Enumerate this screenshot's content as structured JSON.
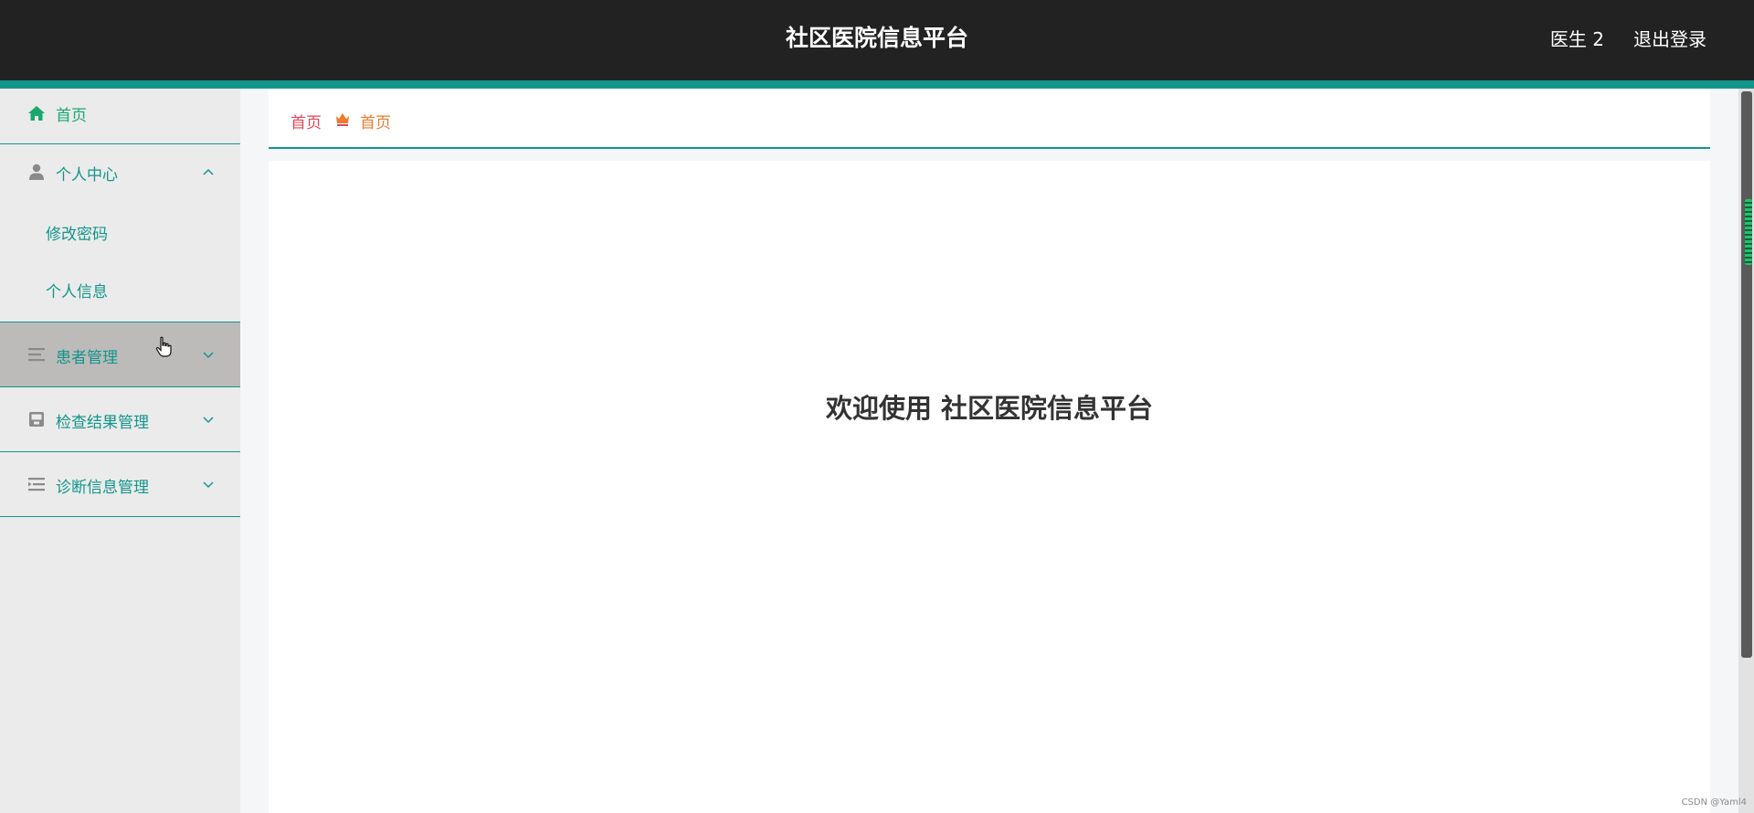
{
  "header": {
    "title": "社区医院信息平台",
    "user": "医生 2",
    "logout": "退出登录"
  },
  "sidebar": {
    "items": [
      {
        "label": "首页",
        "icon": "home-icon"
      },
      {
        "label": "个人中心",
        "icon": "user-icon",
        "expanded": true,
        "children": [
          {
            "label": "修改密码"
          },
          {
            "label": "个人信息"
          }
        ]
      },
      {
        "label": "患者管理",
        "icon": "list-icon",
        "expanded": false,
        "hovered": true
      },
      {
        "label": "检查结果管理",
        "icon": "inbox-icon",
        "expanded": false
      },
      {
        "label": "诊断信息管理",
        "icon": "indent-list-icon",
        "expanded": false
      }
    ]
  },
  "breadcrumb": {
    "root": "首页",
    "current": "首页"
  },
  "main": {
    "welcome": "欢迎使用 社区医院信息平台"
  },
  "watermark": "CSDN @Yaml4",
  "colors": {
    "header_bg": "#222222",
    "accent": "#12968a",
    "home_green": "#1aa76e",
    "sidebar_bg": "#ebebeb",
    "hover_bg": "#bdbaba",
    "crumb_red": "#e0455a",
    "crumb_orange": "#f07a2d"
  }
}
